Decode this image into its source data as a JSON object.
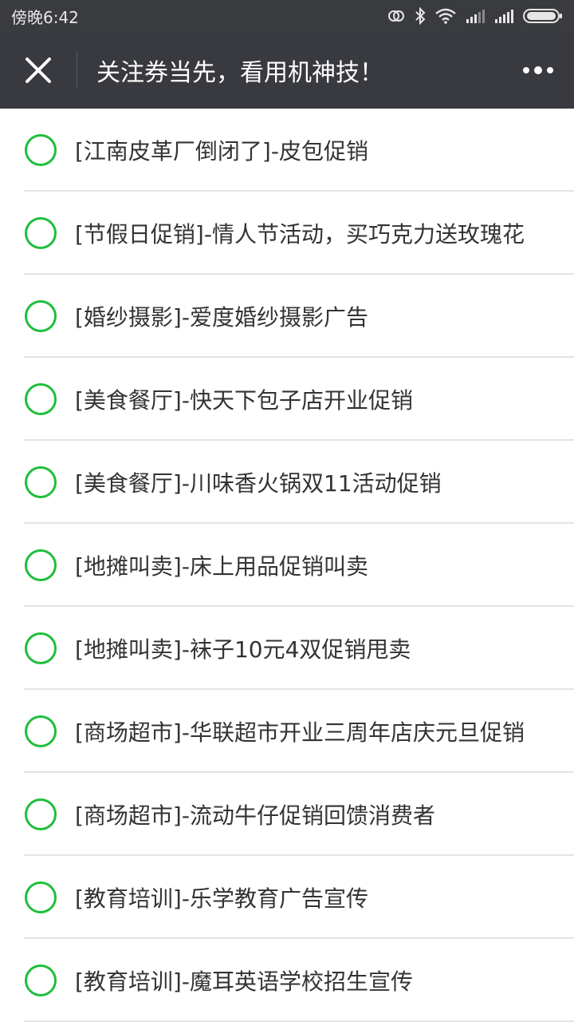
{
  "status_bar": {
    "time": "傍晚6:42",
    "icons": [
      "link-icon",
      "bluetooth-icon",
      "wifi-icon",
      "signal-icon",
      "signal-icon",
      "battery-icon"
    ]
  },
  "nav": {
    "title": "关注券当先，看用机神技！",
    "close_icon": "close-icon",
    "more_icon": "more-icon"
  },
  "colors": {
    "status_bar_bg": "#3a3b3f",
    "nav_bg": "#393a3f",
    "radio_green": "#1fbe3c",
    "divider": "#e4e4e4",
    "text": "#333333"
  },
  "list": {
    "items": [
      {
        "label": "[江南皮革厂倒闭了]-皮包促销",
        "selected": false
      },
      {
        "label": "[节假日促销]-情人节活动，买巧克力送玫瑰花",
        "selected": false
      },
      {
        "label": "[婚纱摄影]-爱度婚纱摄影广告",
        "selected": false
      },
      {
        "label": "[美食餐厅]-快天下包子店开业促销",
        "selected": false
      },
      {
        "label": "[美食餐厅]-川味香火锅双11活动促销",
        "selected": false
      },
      {
        "label": "[地摊叫卖]-床上用品促销叫卖",
        "selected": false
      },
      {
        "label": "[地摊叫卖]-袜子10元4双促销甩卖",
        "selected": false
      },
      {
        "label": "[商场超市]-华联超市开业三周年店庆元旦促销",
        "selected": false
      },
      {
        "label": "[商场超市]-流动牛仔促销回馈消费者",
        "selected": false
      },
      {
        "label": "[教育培训]-乐学教育广告宣传",
        "selected": false
      },
      {
        "label": "[教育培训]-魔耳英语学校招生宣传",
        "selected": false
      }
    ]
  }
}
